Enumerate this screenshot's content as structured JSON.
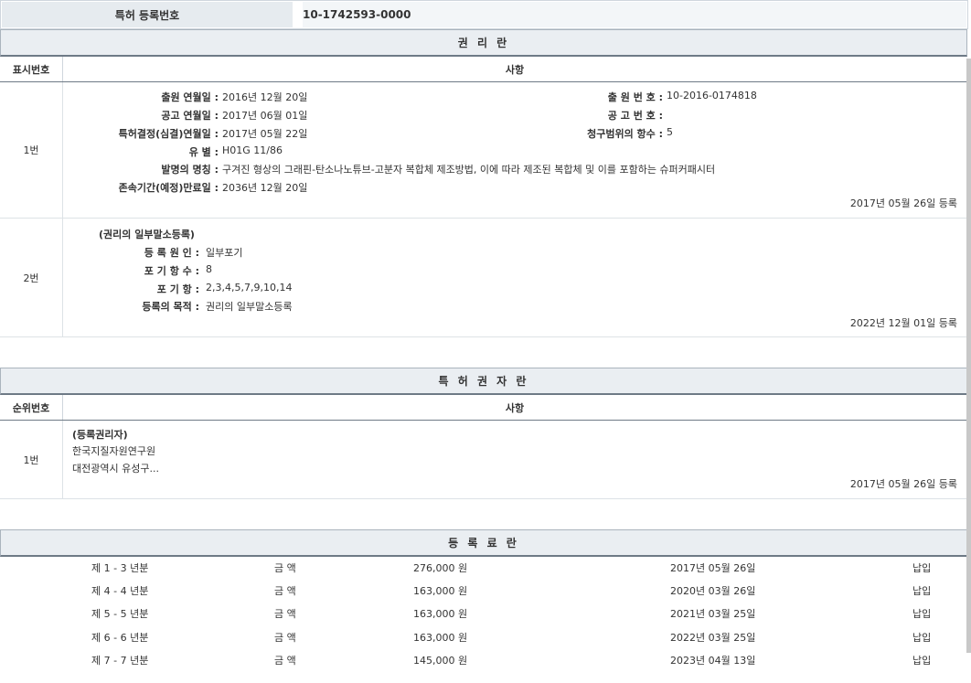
{
  "reg": {
    "label": "특허 등록번호",
    "value": "10-1742593-0000"
  },
  "rights": {
    "title": "권 리 란",
    "col1": "표시번호",
    "col2": "사항",
    "e1": {
      "num": "1번",
      "l1": "출원 연월일 :",
      "v1": "2016년 12월 20일",
      "l2": "공고 연월일 :",
      "v2": "2017년 06월 01일",
      "l3": "특허결정(심결)연월일 :",
      "v3": "2017년 05월 22일",
      "l4": "유 별 :",
      "v4": "H01G 11/86",
      "l5": "발명의 명칭 :",
      "v5": "구겨진 형상의 그래핀-탄소나노튜브-고분자 복합체 제조방법, 이에 따라 제조된 복합체 및 이를 포함하는 슈퍼커패시터",
      "l6": "존속기간(예정)만료일 :",
      "v6": "2036년 12월 20일",
      "r1": "출 원 번 호 :",
      "rv1": "10-2016-0174818",
      "r2": "공 고 번 호 :",
      "rv2": "",
      "r3": "청구범위의 항수 :",
      "rv3": "5",
      "date": "2017년 05월 26일 등록"
    },
    "e2": {
      "num": "2번",
      "head": "(권리의 일부말소등록)",
      "l1": "등 록 원 인 :",
      "v1": "일부포기",
      "l2": "포 기 항 수 :",
      "v2": "8",
      "l3": "포 기 항 :",
      "v3": "2,3,4,5,7,9,10,14",
      "l4": "등록의 목적 :",
      "v4": "권리의 일부말소등록",
      "date": "2022년 12월 01일 등록"
    }
  },
  "owners": {
    "title": "특 허 권 자 란",
    "col1": "순위번호",
    "col2": "사항",
    "e1": {
      "num": "1번",
      "head": "(등록권리자)",
      "name": "한국지질자원연구원",
      "addr": "대전광역시 유성구...",
      "date": "2017년 05월 26일 등록"
    }
  },
  "fees": {
    "title": "등 록 료 란",
    "rows": [
      {
        "period": "제 1 - 3 년분",
        "label": "금 액",
        "amount": "276,000 원",
        "date": "2017년 05월 26일",
        "status": "납입"
      },
      {
        "period": "제 4 - 4 년분",
        "label": "금 액",
        "amount": "163,000 원",
        "date": "2020년 03월 26일",
        "status": "납입"
      },
      {
        "period": "제 5 - 5 년분",
        "label": "금 액",
        "amount": "163,000 원",
        "date": "2021년 03월 25일",
        "status": "납입"
      },
      {
        "period": "제 6 - 6 년분",
        "label": "금 액",
        "amount": "163,000 원",
        "date": "2022년 03월 25일",
        "status": "납입"
      },
      {
        "period": "제 7 - 7 년분",
        "label": "금 액",
        "amount": "145,000 원",
        "date": "2023년 04월 13일",
        "status": "납입"
      }
    ]
  }
}
